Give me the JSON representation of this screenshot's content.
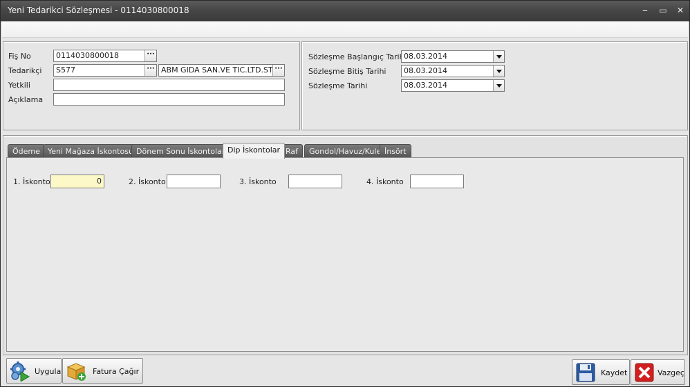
{
  "window": {
    "title": "Yeni Tedarikci Sözleşmesi - 0114030800018",
    "minimize": "‒",
    "maximize": "▭",
    "close": "✕"
  },
  "header_left": {
    "fis_no_label": "Fiş No",
    "fis_no_value": "0114030800018",
    "tedarikci_label": "Tedarikçi",
    "tedarikci_code": "S577",
    "tedarikci_name": "ABM GIDA SAN.VE TIC.LTD.STI.",
    "yetkili_label": "Yetkili",
    "yetkili_value": "",
    "aciklama_label": "Açıklama",
    "aciklama_value": "",
    "ellipsis": "···"
  },
  "header_right": {
    "baslangic_label": "Sözleşme Başlangıç Tarihi",
    "baslangic_value": "08.03.2014",
    "bitis_label": "Sözleşme Bitiş Tarihi",
    "bitis_value": "08.03.2014",
    "tarih_label": "Sözleşme Tarihi",
    "tarih_value": "08.03.2014"
  },
  "tabs": [
    {
      "label": "Ödeme"
    },
    {
      "label": "Yeni Mağaza İskontosu"
    },
    {
      "label": "Dönem Sonu İskontoları"
    },
    {
      "label": "Dip İskontolar"
    },
    {
      "label": "Raf"
    },
    {
      "label": "Gondol/Havuz/Kule"
    },
    {
      "label": "İnsört"
    }
  ],
  "active_tab": "Dip İskontolar",
  "discounts": {
    "iskonto1_label": "1. İskonto",
    "iskonto1_value": "0",
    "iskonto2_label": "2. İskonto",
    "iskonto2_value": "",
    "iskonto3_label": "3. İskonto",
    "iskonto3_value": "",
    "iskonto4_label": "4. İskonto",
    "iskonto4_value": ""
  },
  "buttons": {
    "uygula": "Uygula",
    "fatura_cagir": "Fatura Çağır",
    "kaydet": "Kaydet",
    "vazgec": "Vazgeç"
  },
  "colors": {
    "titlebar": "#474747",
    "active_field": "#fdf8c8",
    "tab_inactive": "#555555",
    "cancel_red": "#d21f1f",
    "save_blue": "#2c5aa0"
  }
}
